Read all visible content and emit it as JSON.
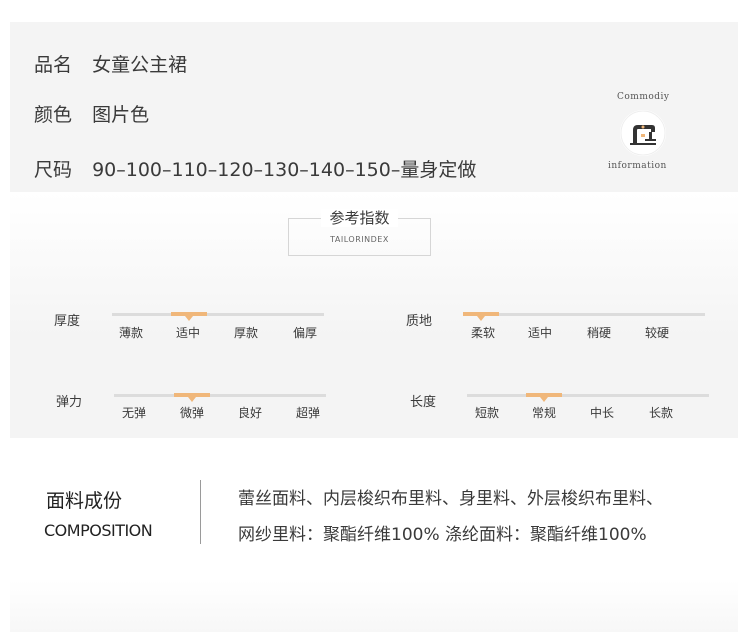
{
  "info": {
    "name_label": "品名",
    "name_value": "女童公主裙",
    "color_label": "颜色",
    "color_value": "图片色",
    "size_label": "尺码",
    "size_value": "90–100–110–120–130–140–150–量身定做",
    "badge_top": "Commodiy",
    "badge_bottom": "information",
    "badge_icon": "sewing-machine-icon"
  },
  "reference": {
    "title": "参考指数",
    "subtitle": "TAILORINDEX",
    "accent_color": "#f0b77a",
    "scales": {
      "thickness": {
        "label": "厚度",
        "options": [
          "薄款",
          "适中",
          "厚款",
          "偏厚"
        ],
        "selected_index": 1
      },
      "texture": {
        "label": "质地",
        "options": [
          "柔软",
          "适中",
          "稍硬",
          "较硬"
        ],
        "selected_index": 0
      },
      "elasticity": {
        "label": "弹力",
        "options": [
          "无弹",
          "微弹",
          "良好",
          "超弹"
        ],
        "selected_index": 1
      },
      "length": {
        "label": "长度",
        "options": [
          "短款",
          "常规",
          "中长",
          "长款"
        ],
        "selected_index": 1
      }
    }
  },
  "composition": {
    "title": "面料成份",
    "title_en": "COMPOSITION",
    "line1": "蕾丝面料、内层梭织布里料、身里料、外层梭织布里料、",
    "line2": "网纱里料：聚酯纤维100%  涤纶面料：聚酯纤维100%"
  }
}
